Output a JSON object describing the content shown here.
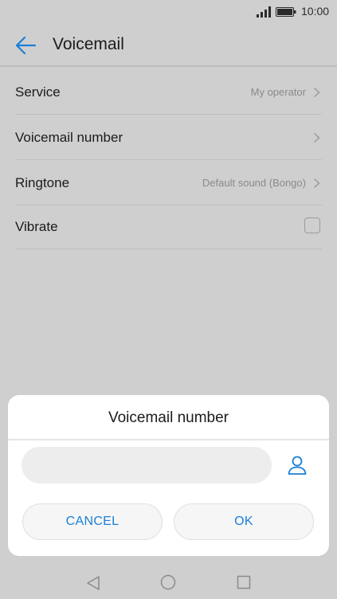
{
  "status_bar": {
    "time": "10:00",
    "icons": [
      "signal-icon",
      "battery-icon"
    ]
  },
  "header": {
    "title": "Voicemail",
    "back_icon": "back-arrow-icon"
  },
  "settings": [
    {
      "label": "Service",
      "value": "My operator",
      "control": "chevron"
    },
    {
      "label": "Voicemail number",
      "value": "",
      "control": "chevron"
    },
    {
      "label": "Ringtone",
      "value": "Default sound (Bongo)",
      "control": "chevron"
    },
    {
      "label": "Vibrate",
      "value": "",
      "control": "checkbox",
      "checked": false
    }
  ],
  "dialog": {
    "title": "Voicemail number",
    "input_value": "",
    "contact_icon": "contact-person-icon",
    "cancel_label": "CANCEL",
    "ok_label": "OK"
  },
  "nav_bar": {
    "icons": [
      "nav-back-icon",
      "nav-home-icon",
      "nav-recent-icon"
    ]
  },
  "colors": {
    "accent": "#1a7fd6",
    "scrim_background": "#cfcfcf",
    "dialog_background": "#ffffff"
  }
}
